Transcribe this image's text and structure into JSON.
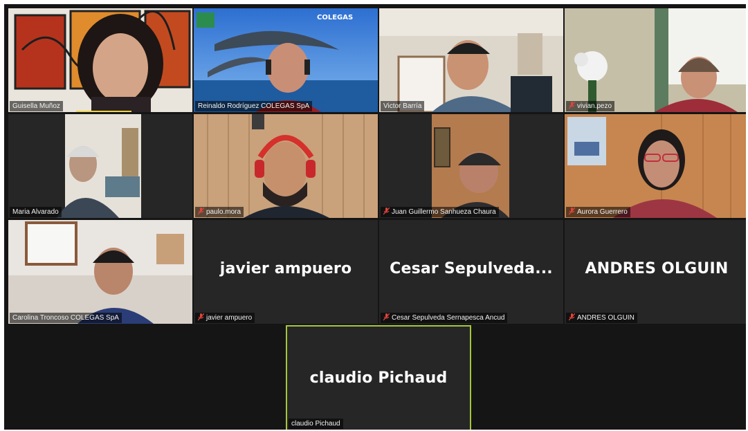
{
  "participants": [
    {
      "name": "Guisella Muñoz",
      "muted": false,
      "video": true
    },
    {
      "name": "Reinaldo Rodríguez  COLEGAS SpA",
      "muted": false,
      "video": true,
      "background_text": "COLEGAS"
    },
    {
      "name": "Victor Barría",
      "muted": false,
      "video": true
    },
    {
      "name": "vivian.pezo",
      "muted": true,
      "video": true
    },
    {
      "name": "Maria Alvarado",
      "muted": false,
      "video": true
    },
    {
      "name": "paulo.mora",
      "muted": true,
      "video": true
    },
    {
      "name": "Juan Guillermo Sanhueza Chaura",
      "muted": true,
      "video": true
    },
    {
      "name": "Aurora Guerrero",
      "muted": true,
      "video": true
    },
    {
      "name": "Carolina Troncoso COLEGAS SpA",
      "muted": false,
      "video": true
    },
    {
      "name": "javier ampuero",
      "display": "javier ampuero",
      "muted": true,
      "video": false
    },
    {
      "name": "Cesar Sepulveda Sernapesca Ancud",
      "display": "Cesar  Sepulveda...",
      "muted": true,
      "video": false
    },
    {
      "name": "ANDRES OLGUIN",
      "display": "ANDRES OLGUIN",
      "muted": true,
      "video": false
    },
    {
      "name": "claudio Pichaud",
      "display": "claudio Pichaud",
      "muted": false,
      "video": false,
      "active_speaker": true
    }
  ],
  "colors": {
    "background": "#151515",
    "tile": "#262626",
    "active_border": "#a6c63a",
    "muted_icon": "#e0443c",
    "speaking_indicator": "#f3d44a"
  }
}
